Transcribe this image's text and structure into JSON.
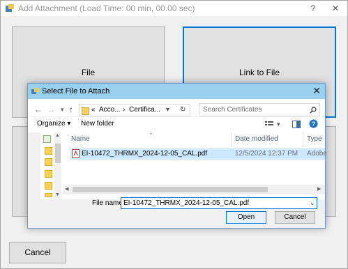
{
  "window": {
    "title": "Add Attachment (Load Time: 00 min, 00.00 sec)",
    "help": "?",
    "close": "✕"
  },
  "main": {
    "file_label": "File",
    "link_label": "Link to File",
    "cancel_label": "Cancel"
  },
  "dialog": {
    "title": "Select File to Attach",
    "close": "✕",
    "back": "←",
    "forward": "→",
    "recent": "▾",
    "up": "↑",
    "address": {
      "prefix": "«",
      "crumb1": "Acco...",
      "sep": "›",
      "crumb2": "Certifica...",
      "dropdown": "▾",
      "refresh": "↻"
    },
    "search_placeholder": "Search Certificates",
    "organize": "Organize ▾",
    "new_folder": "New folder",
    "columns": {
      "name": "Name",
      "date": "Date modified",
      "type": "Type"
    },
    "file": {
      "name": "EI-10472_THRMX_2024-12-05_CAL.pdf",
      "date": "12/5/2024 12:37 PM",
      "type": "Adobe"
    },
    "filename_label": "File name:",
    "filename_value": "EI-10472_THRMX_2024-12-05_CAL.pdf",
    "open_label": "Open",
    "cancel_label": "Cancel"
  }
}
